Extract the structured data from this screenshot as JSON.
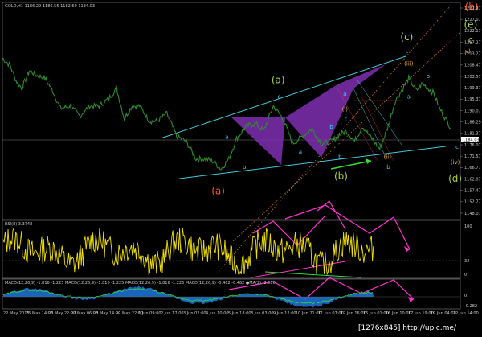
{
  "window": {
    "chart_title": "GOLD,H1  1186.29 1186.55 1182.69 1184.03",
    "rsi_title": "RSI(8) 3.3748",
    "macd_title": "MACD(12,26,9) -1.816 -1.225  MACD(12,26,9) -1.816 -1.225  MACD(12,26,9) -1.816 -1.225  MACD(12,26,9) -0.462 -0.462  ●MA(2) -2.016",
    "watermark": "[1276x845] http://upic.me/"
  },
  "colors": {
    "price_line": "#2e8b2e",
    "channel": "#46c8d8",
    "triangle": "#7e2fb0",
    "fib_dotted": "#d2781e",
    "rsi_line": "#f0e000",
    "pink_arrows": "#ff33cc",
    "green_arrow": "#33dd33",
    "wave_cyan": "#33d6ff",
    "wave_yellowgreen": "#a8d04a",
    "wave_orange": "#ff5522",
    "wave_gold": "#e8a838"
  },
  "chart_data": [
    {
      "type": "line",
      "panel": "main",
      "y_ticks": [
        "1231.97",
        "1227.07",
        "1222.17",
        "1217.27",
        "1213.27",
        "1208.47",
        "1203.57",
        "1199.37",
        "1195.37",
        "1190.07",
        "1186.29",
        "1181.37",
        "1176.07",
        "1171.57",
        "1166.77",
        "1162.07",
        "1157.47",
        "1152.77",
        "1148.07"
      ],
      "current_price": "1184.03",
      "ylim": [
        1148,
        1234
      ],
      "series": [
        {
          "x": [
            0,
            8,
            14,
            20,
            28,
            36,
            44,
            52,
            60,
            70,
            80,
            90,
            100,
            110,
            118,
            126,
            134,
            142,
            152,
            160,
            170,
            180,
            190,
            200,
            210,
            218,
            226,
            234,
            242,
            252,
            262,
            270,
            280,
            290,
            300,
            310,
            320,
            330,
            340,
            350,
            356,
            364,
            372,
            380,
            390,
            398,
            406,
            414,
            420,
            428,
            434,
            440,
            446,
            452,
            458,
            464
          ],
          "y": [
            1212,
            1209,
            1203,
            1200,
            1207,
            1205,
            1204,
            1199,
            1192,
            1193,
            1189,
            1193,
            1193,
            1196,
            1200,
            1188,
            1193,
            1193,
            1187,
            1187,
            1190,
            1181,
            1179,
            1172,
            1172,
            1171,
            1168,
            1172,
            1180,
            1185,
            1186,
            1183,
            1193,
            1188,
            1178,
            1181,
            1184,
            1178,
            1179,
            1182,
            1183,
            1179,
            1185,
            1181,
            1176,
            1184,
            1195,
            1200,
            1204,
            1199,
            1202,
            1200,
            1198,
            1192,
            1188,
            1184
          ]
        }
      ],
      "wave_labels": [
        {
          "text": "(a)",
          "color": "#a8d04a",
          "x": 285,
          "y": 1202
        },
        {
          "text": "(b)",
          "color": "#a8d04a",
          "x": 350,
          "y": 1164
        },
        {
          "text": "(c)",
          "color": "#a8d04a",
          "x": 418,
          "y": 1219
        },
        {
          "text": "(d)",
          "color": "#a8d04a",
          "x": 468,
          "y": 1163
        },
        {
          "text": "(e)",
          "color": "#a8d04a",
          "x": 484,
          "y": 1224
        },
        {
          "text": "c",
          "color": "#a8d04a",
          "x": 484,
          "y": 1218
        },
        {
          "text": "(a)",
          "color": "#ff5522",
          "x": 223,
          "y": 1158
        },
        {
          "text": "(b)",
          "color": "#ff5522",
          "x": 485,
          "y": 1231
        },
        {
          "text": "(i)",
          "color": "#e8a838",
          "x": 354,
          "y": 1191
        },
        {
          "text": "(ii)",
          "color": "#e8a838",
          "x": 398,
          "y": 1172
        },
        {
          "text": "(iii)",
          "color": "#e8a838",
          "x": 420,
          "y": 1209
        },
        {
          "text": "(iv)",
          "color": "#e8a838",
          "x": 468,
          "y": 1170
        },
        {
          "text": "(v)",
          "color": "#e8a838",
          "x": 480,
          "y": 1214
        },
        {
          "text": "a",
          "color": "#33d6ff",
          "x": 232,
          "y": 1180
        },
        {
          "text": "b",
          "color": "#33d6ff",
          "x": 250,
          "y": 1168
        },
        {
          "text": "c",
          "color": "#33d6ff",
          "x": 286,
          "y": 1196
        },
        {
          "text": "a",
          "color": "#33d6ff",
          "x": 308,
          "y": 1174
        },
        {
          "text": "b",
          "color": "#33d6ff",
          "x": 340,
          "y": 1184
        },
        {
          "text": "b",
          "color": "#33d6ff",
          "x": 349,
          "y": 1172
        },
        {
          "text": "a",
          "color": "#33d6ff",
          "x": 354,
          "y": 1197
        },
        {
          "text": "c",
          "color": "#33d6ff",
          "x": 355,
          "y": 1187
        },
        {
          "text": "b",
          "color": "#33d6ff",
          "x": 399,
          "y": 1168
        },
        {
          "text": "c",
          "color": "#33d6ff",
          "x": 418,
          "y": 1213
        },
        {
          "text": "a",
          "color": "#33d6ff",
          "x": 420,
          "y": 1196
        },
        {
          "text": "b",
          "color": "#33d6ff",
          "x": 440,
          "y": 1204
        },
        {
          "text": "c",
          "color": "#33d6ff",
          "x": 470,
          "y": 1176
        }
      ]
    },
    {
      "type": "line",
      "panel": "rsi",
      "y_ticks": [
        "100",
        "32",
        "0"
      ],
      "ylim": [
        0,
        100
      ]
    },
    {
      "type": "area",
      "panel": "macd",
      "y_ticks": [
        "0",
        "-0.282"
      ]
    }
  ],
  "time_axis": [
    "22 May 2015",
    "25 May 14:00",
    "26 May 22:00",
    "27 May 06:00",
    "28 May 14:00",
    "29 May 22:00",
    "1 Jun 09:00",
    "2 Jun 17:00",
    "3 Jun 02:00",
    "4 Jun 10:00",
    "5 Jun 18:00",
    "8 Jun 03:00",
    "9 Jun 12:00",
    "10 Jun 21:00",
    "11 Jun 07:00",
    "12 Jun 16:00",
    "15 Jun 01:00",
    "16 Jun 10:00",
    "17 Jun 19:00",
    "19 Jun 04:00",
    "22 Jun 14:00"
  ]
}
